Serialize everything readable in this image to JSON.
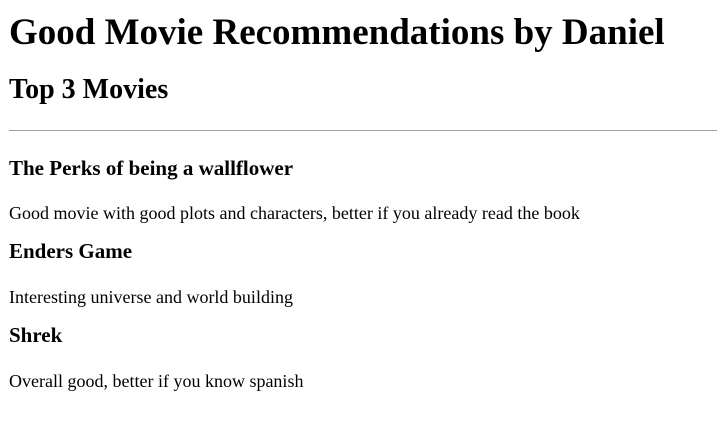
{
  "page": {
    "title": "Good Movie Recommendations by Daniel",
    "section_heading": "Top 3 Movies"
  },
  "movies": [
    {
      "title": "The Perks of being a wallflower",
      "description": "Good movie with good plots and characters, better if you already read the book"
    },
    {
      "title": "Enders Game",
      "description": "Interesting universe and world building"
    },
    {
      "title": "Shrek",
      "description": "Overall good, better if you know spanish"
    }
  ],
  "colors": {
    "text": "#000000",
    "background": "#ffffff",
    "divider": "#a0a0a0"
  }
}
